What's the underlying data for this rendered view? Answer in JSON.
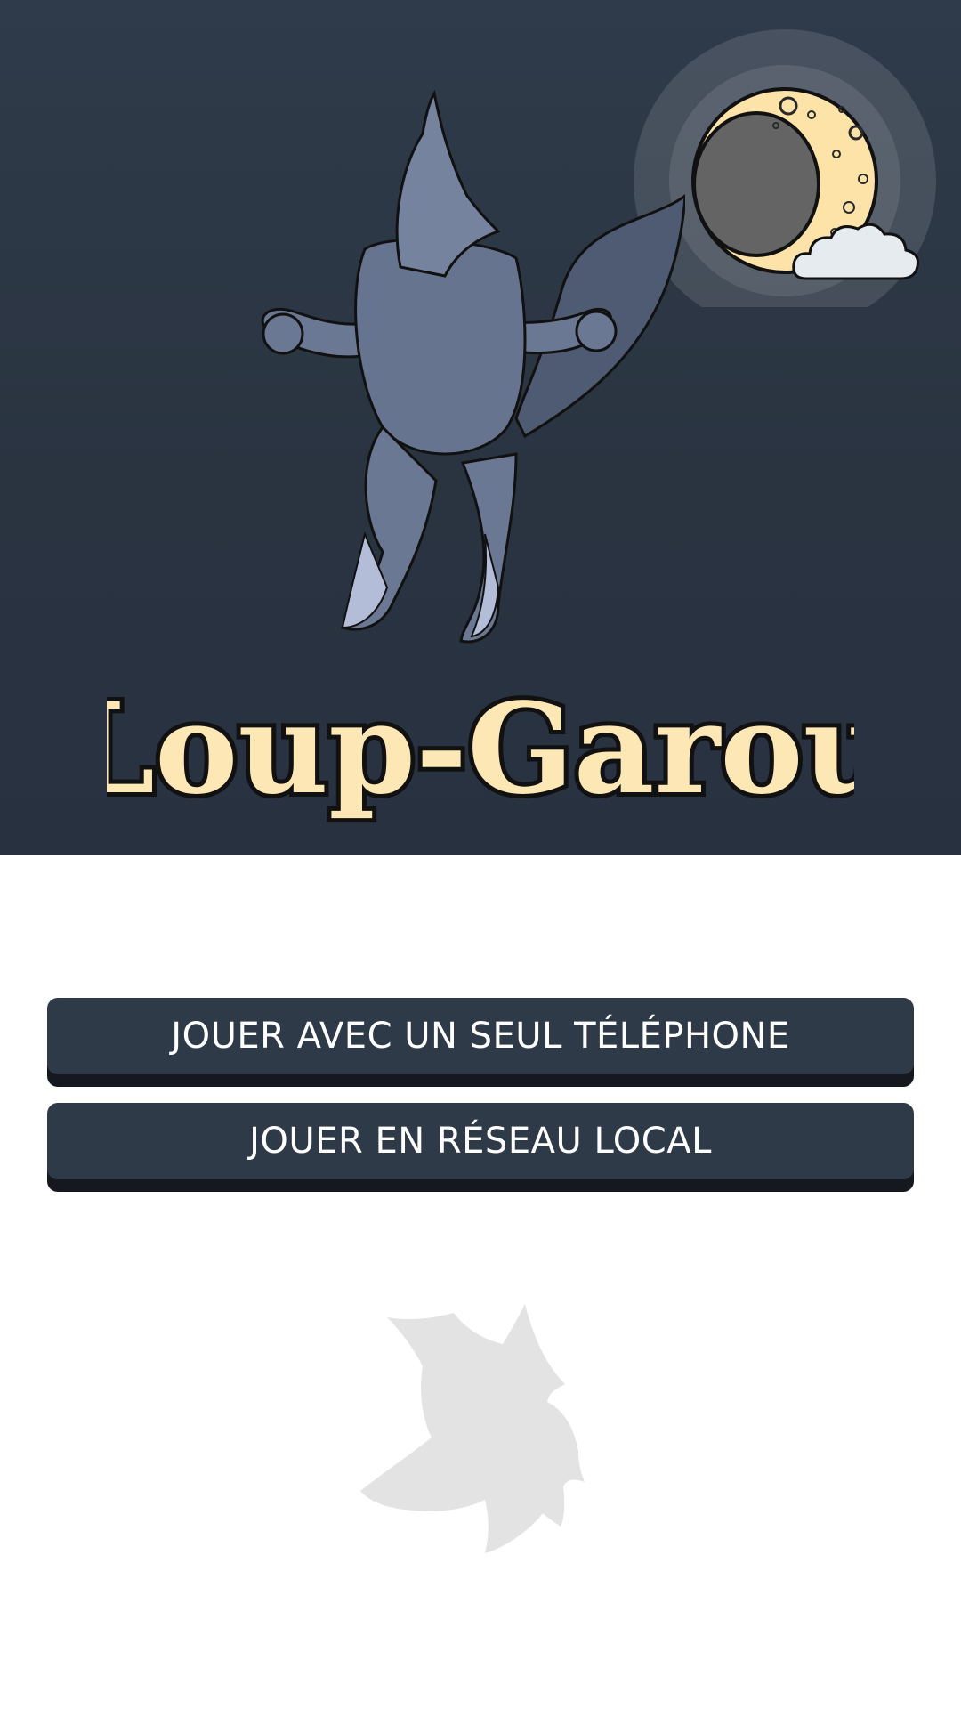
{
  "app": {
    "title": "Loup-Garou"
  },
  "menu": {
    "single_phone_label": "JOUER AVEC UN SEUL TÉLÉPHONE",
    "local_network_label": "JOUER EN RÉSEAU LOCAL"
  },
  "colors": {
    "hero_background": "#2c3644",
    "button_background": "#2f3a48",
    "button_shadow": "#15191f",
    "title_fill": "#fde7b5",
    "moon_fill": "#fde3a8",
    "wolf_fill": "#6b7894",
    "footer_logo": "#e2e2e2"
  },
  "icons": {
    "moon": "moon-icon",
    "cloud": "cloud-icon",
    "wolf": "howling-wolf-illustration",
    "footer": "wolf-head-icon"
  }
}
